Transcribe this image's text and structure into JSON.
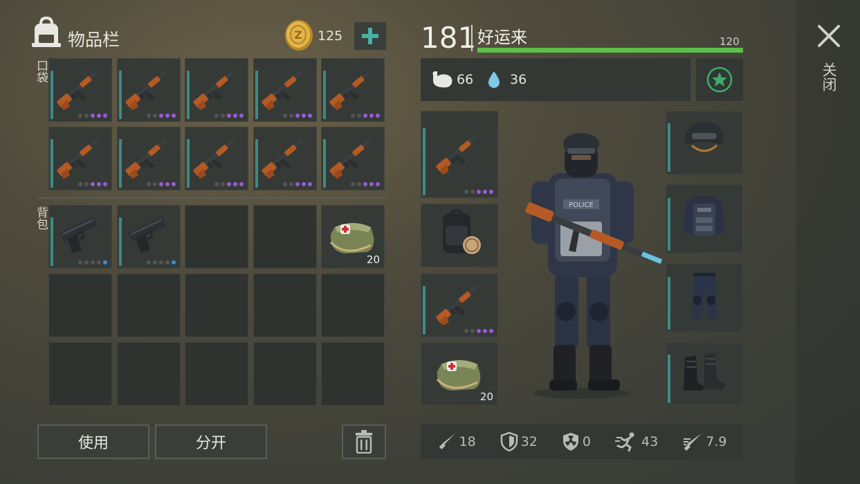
{
  "inventory": {
    "title": "物品栏",
    "coins": "125",
    "pocket_label": "口袋",
    "backpack_label": "背包",
    "pocket_items": [
      {
        "icon": "ak47-rifle"
      },
      {
        "icon": "ak47-rifle"
      },
      {
        "icon": "ak47-rifle"
      },
      {
        "icon": "ak47-rifle"
      },
      {
        "icon": "ak47-rifle"
      },
      {
        "icon": "ak47-rifle"
      },
      {
        "icon": "ak47-rifle"
      },
      {
        "icon": "ak47-rifle"
      },
      {
        "icon": "ak47-rifle"
      },
      {
        "icon": "ak47-rifle"
      }
    ],
    "backpack_items": [
      {
        "icon": "pistol"
      },
      {
        "icon": "pistol"
      },
      {
        "icon": "empty"
      },
      {
        "icon": "empty"
      },
      {
        "icon": "medkit-bag",
        "count": "20"
      },
      {
        "icon": "empty"
      },
      {
        "icon": "empty"
      },
      {
        "icon": "empty"
      },
      {
        "icon": "empty"
      },
      {
        "icon": "empty"
      },
      {
        "icon": "empty"
      },
      {
        "icon": "empty"
      },
      {
        "icon": "empty"
      },
      {
        "icon": "empty"
      },
      {
        "icon": "empty"
      }
    ],
    "use_label": "使用",
    "split_label": "分开"
  },
  "player": {
    "level": "181",
    "name": "好运来",
    "xp_max": "120",
    "xp_fraction": 1.0,
    "hunger": "66",
    "thirst": "36"
  },
  "equipment": {
    "left": [
      {
        "icon": "ak47-rifle"
      },
      {
        "icon": "backpack"
      },
      {
        "icon": "ak47-rifle"
      },
      {
        "icon": "medkit-bag",
        "count": "20"
      }
    ],
    "right": [
      {
        "icon": "helmet"
      },
      {
        "icon": "police-vest"
      },
      {
        "icon": "armored-pants"
      },
      {
        "icon": "boots"
      }
    ]
  },
  "stats": {
    "attack": "18",
    "defense": "32",
    "radiation": "0",
    "speed": "43",
    "stealth": "7.9"
  },
  "close_label": "关闭",
  "colors": {
    "accent": "#46b0a4",
    "xp": "#5cbf4a",
    "rarity": "#9a5bd6"
  }
}
